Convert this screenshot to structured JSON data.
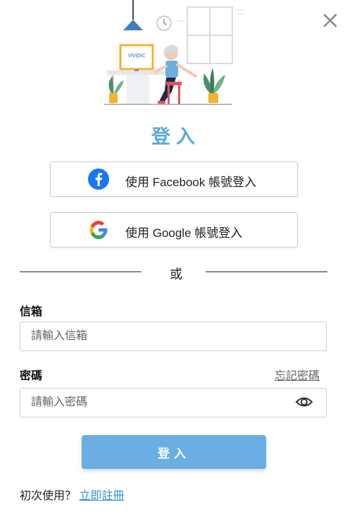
{
  "header": {
    "close_icon": "close-icon"
  },
  "illustration": {
    "monitor_text": "vivipic"
  },
  "title": "登入",
  "social": {
    "facebook_label": "使用 Facebook 帳號登入",
    "google_label": "使用 Google 帳號登入"
  },
  "divider_text": "或",
  "email": {
    "label": "信箱",
    "placeholder": "請輸入信箱"
  },
  "password": {
    "label": "密碼",
    "placeholder": "請輸入密碼",
    "forgot_label": "忘記密碼"
  },
  "submit_label": "登入",
  "footer": {
    "prompt": "初次使用？",
    "register_link": "立即註冊"
  },
  "colors": {
    "accent": "#5aa9dd",
    "button": "#6aaee3",
    "facebook": "#1877f2",
    "link": "#2f8fd8"
  }
}
